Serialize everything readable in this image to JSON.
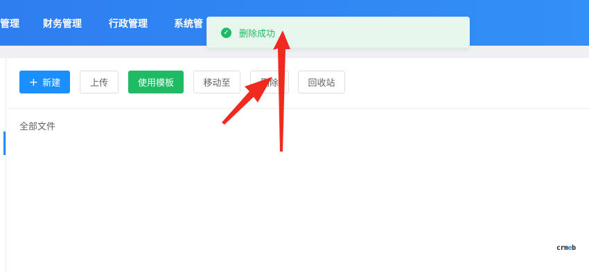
{
  "nav": {
    "items": [
      "管理",
      "财务管理",
      "行政管理",
      "系统管"
    ]
  },
  "toolbar": {
    "new_label": "新建",
    "upload_label": "上传",
    "template_label": "使用模板",
    "move_label": "移动至",
    "delete_label": "删除",
    "recycle_label": "回收站"
  },
  "breadcrumb": {
    "label": "全部文件"
  },
  "toast": {
    "message": "删除成功",
    "status": "success"
  },
  "branding": {
    "logo_text": "crmeb"
  },
  "colors": {
    "nav_bg": "#3088f3",
    "primary": "#1a90ff",
    "success": "#1fbb64",
    "annotation_arrow": "#f02a1f"
  },
  "icons": [
    "plus-icon",
    "check-circle-icon",
    "annotation-arrow-icon"
  ]
}
